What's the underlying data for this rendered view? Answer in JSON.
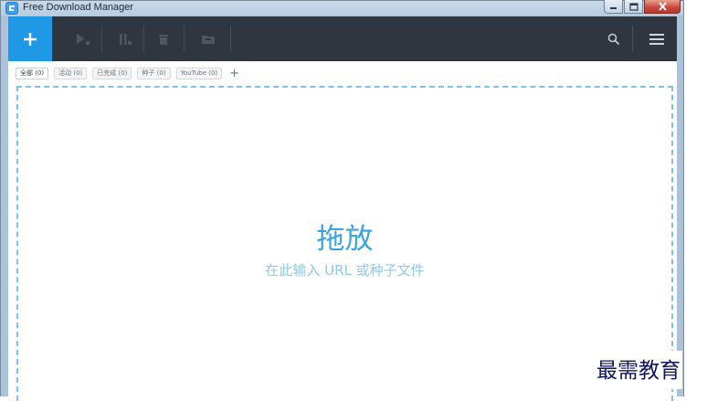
{
  "window": {
    "title": "Free Download Manager"
  },
  "toolbar": {
    "add_icon": "plus-icon",
    "resume_icon": "play-icon",
    "pause_icon": "pause-icon",
    "delete_icon": "trash-icon",
    "move_icon": "folder-icon",
    "search_icon": "search-icon",
    "menu_icon": "menu-icon",
    "colors": {
      "bar": "#303640",
      "add": "#1f99e6"
    }
  },
  "tabs": [
    {
      "label": "全部 (0)",
      "active": true
    },
    {
      "label": "活动 (0)"
    },
    {
      "label": "已完成 (0)"
    },
    {
      "label": "种子 (0)"
    },
    {
      "label": "YouTube (0)"
    }
  ],
  "tabs_add": "+",
  "dropzone": {
    "title": "拖放",
    "subtitle": "在此输入 URL 或种子文件",
    "colors": {
      "border": "#7cc2ec",
      "title": "#3aa3e0",
      "subtitle": "#8ec9ee"
    }
  },
  "watermark": "最需教育"
}
